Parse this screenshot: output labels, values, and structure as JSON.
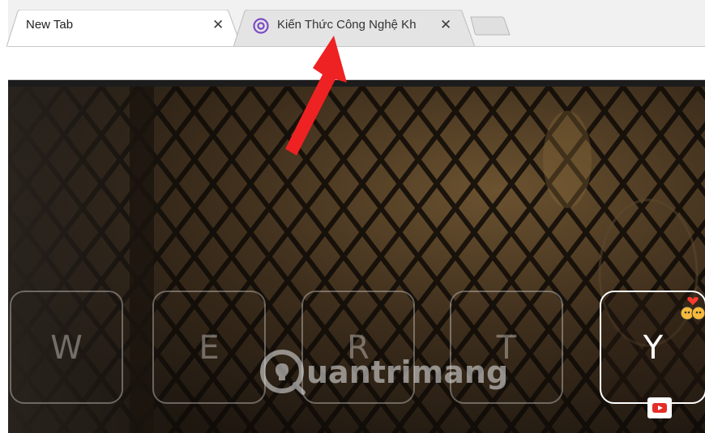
{
  "tabs": [
    {
      "title": "New Tab",
      "close": "✕",
      "active": true
    },
    {
      "title": "Kiến Thức Công Nghệ Kh",
      "close": "✕",
      "active": false,
      "favicon": "at-sign-favicon-icon"
    }
  ],
  "keys": [
    {
      "letter": "W",
      "active": false
    },
    {
      "letter": "E",
      "active": false
    },
    {
      "letter": "R",
      "active": false
    },
    {
      "letter": "T",
      "active": false
    },
    {
      "letter": "Y",
      "active": true,
      "badge": "youtube-icon"
    }
  ],
  "watermark": {
    "text": "uantrimang",
    "logo": "quantrimang-logo"
  },
  "annotation": {
    "icon": "red-arrow-icon",
    "color": "#ee2222"
  },
  "colors": {
    "tabstrip": "#f1f1f1",
    "favicon": "#7b4bc4",
    "youtube": "#e52d27"
  }
}
